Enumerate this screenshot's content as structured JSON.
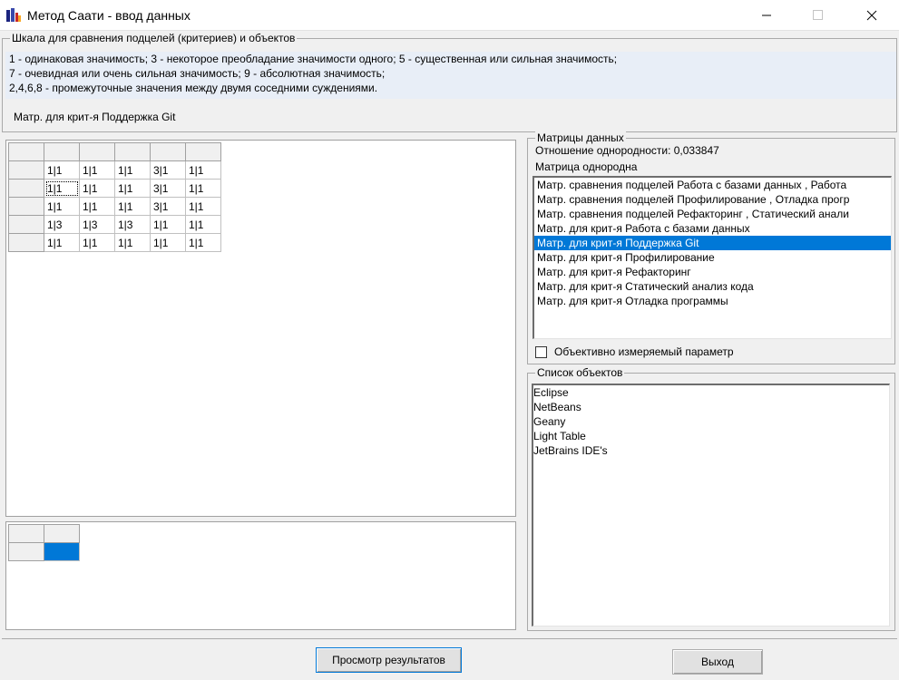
{
  "window": {
    "title": "Метод Саати - ввод данных"
  },
  "scale": {
    "legend": "Шкала для сравнения подцелей (критериев) и объектов",
    "lines": [
      "1 - одинаковая значимость; 3 - некоторое преобладание значимости одного; 5 - существенная или сильная значимость;",
      "7 - очевидная или очень сильная значимость; 9 - абсолютная значимость;",
      "2,4,6,8 - промежуточные значения между двумя соседними суждениями."
    ],
    "current_matrix": "Матр. для крит-я Поддержка Git"
  },
  "matrix": {
    "rows": [
      [
        "1|1",
        "1|1",
        "1|1",
        "3|1",
        "1|1"
      ],
      [
        "1|1",
        "1|1",
        "1|1",
        "3|1",
        "1|1"
      ],
      [
        "1|1",
        "1|1",
        "1|1",
        "3|1",
        "1|1"
      ],
      [
        "1|3",
        "1|3",
        "1|3",
        "1|1",
        "1|1"
      ],
      [
        "1|1",
        "1|1",
        "1|1",
        "1|1",
        "1|1"
      ]
    ]
  },
  "data_matrices": {
    "legend": "Матрицы данных",
    "homogeneity": "Отношение однородности: 0,033847",
    "status": "Матрица однородна",
    "items": [
      "Матр. сравнения подцелей Работа с базами данных , Работа",
      "Матр. сравнения подцелей Профилирование , Отладка прогр",
      "Матр. сравнения подцелей Рефакторинг , Статический анали",
      "Матр. для крит-я Работа с базами данных",
      "Матр. для крит-я Поддержка Git",
      "Матр. для крит-я Профилирование",
      "Матр. для крит-я Рефакторинг",
      "Матр. для крит-я Статический анализ кода",
      "Матр. для крит-я Отладка программы"
    ],
    "selected_index": 4,
    "checkbox_label": "Объективно измеряемый параметр",
    "checkbox_checked": false
  },
  "objects": {
    "legend": "Список объектов",
    "items": [
      "Eclipse",
      "NetBeans",
      "Geany",
      "Light Table",
      "JetBrains IDE's"
    ]
  },
  "buttons": {
    "view_results": "Просмотр результатов",
    "exit": "Выход"
  },
  "colors": {
    "selection": "#0078d7",
    "scale_background": "#e8eef7"
  }
}
